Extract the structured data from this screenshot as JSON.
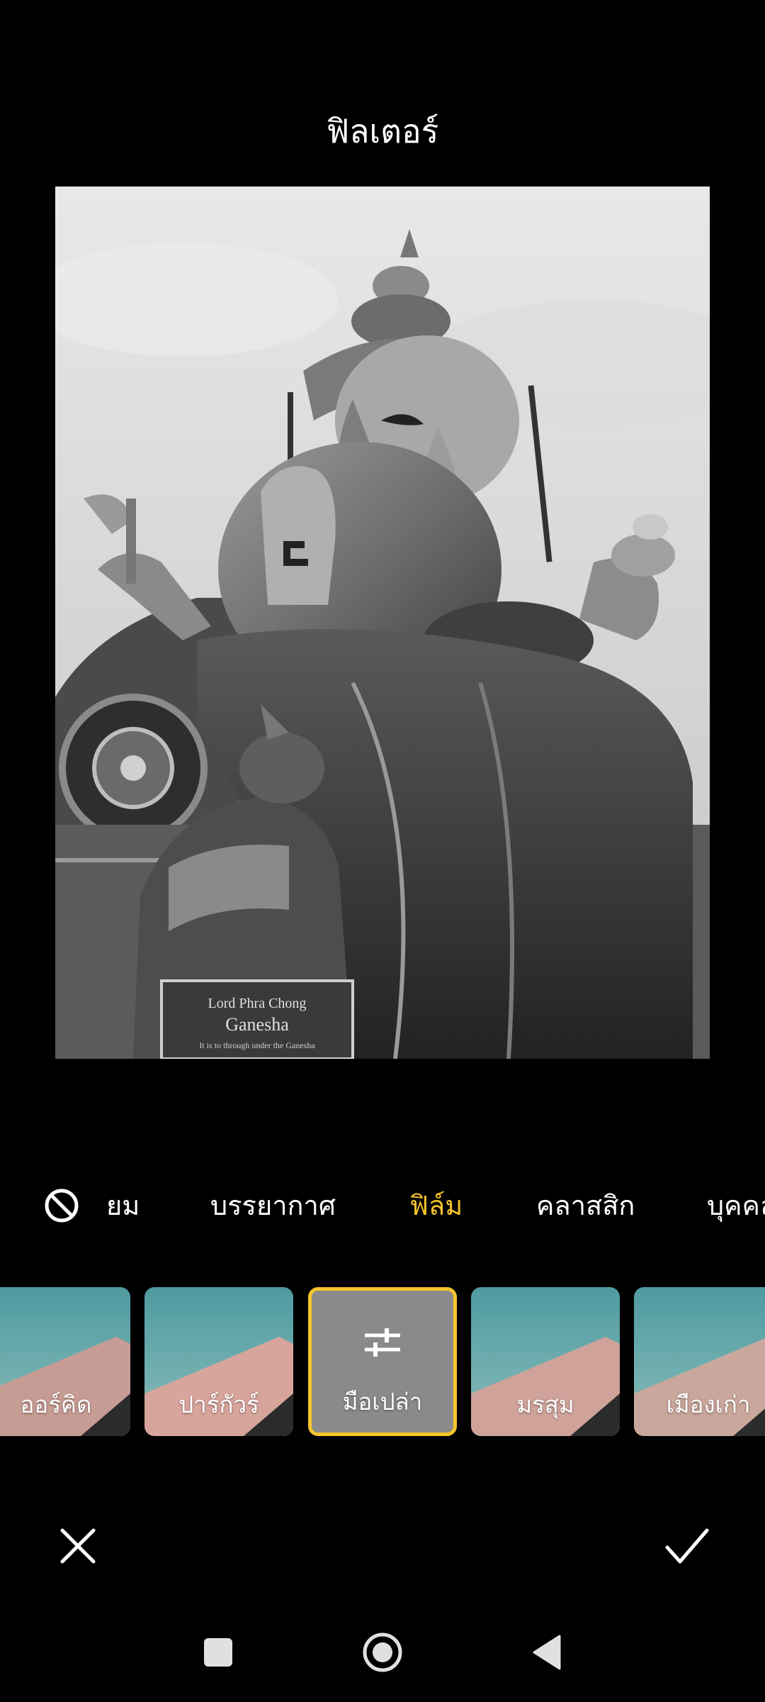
{
  "header": {
    "title": "ฟิลเตอร์"
  },
  "photo": {
    "plaque_line1": "Lord Phra Chong",
    "plaque_line2": "Ganesha",
    "plaque_line3": "It is to through under the Ganesha"
  },
  "categories": {
    "none_icon": "no-filter-icon",
    "items": [
      {
        "label": "ยม",
        "active": false
      },
      {
        "label": "บรรยากาศ",
        "active": false
      },
      {
        "label": "ฟิล์ม",
        "active": true
      },
      {
        "label": "คลาสสิก",
        "active": false
      },
      {
        "label": "บุคคล",
        "active": false
      }
    ]
  },
  "filters": {
    "items": [
      {
        "label": "ออร์คิด",
        "selected": false
      },
      {
        "label": "ปาร์กัวร์",
        "selected": false
      },
      {
        "label": "มือเปล่า",
        "selected": true,
        "icon": "adjust-sliders-icon"
      },
      {
        "label": "มรสุม",
        "selected": false
      },
      {
        "label": "เมืองเก่า",
        "selected": false
      }
    ]
  },
  "actions": {
    "cancel_icon": "close-icon",
    "confirm_icon": "check-icon"
  },
  "navbar": {
    "recents_icon": "square-icon",
    "home_icon": "circle-icon",
    "back_icon": "triangle-back-icon"
  },
  "colors": {
    "accent": "#f5c32b",
    "background": "#000000",
    "text": "#ffffff"
  }
}
